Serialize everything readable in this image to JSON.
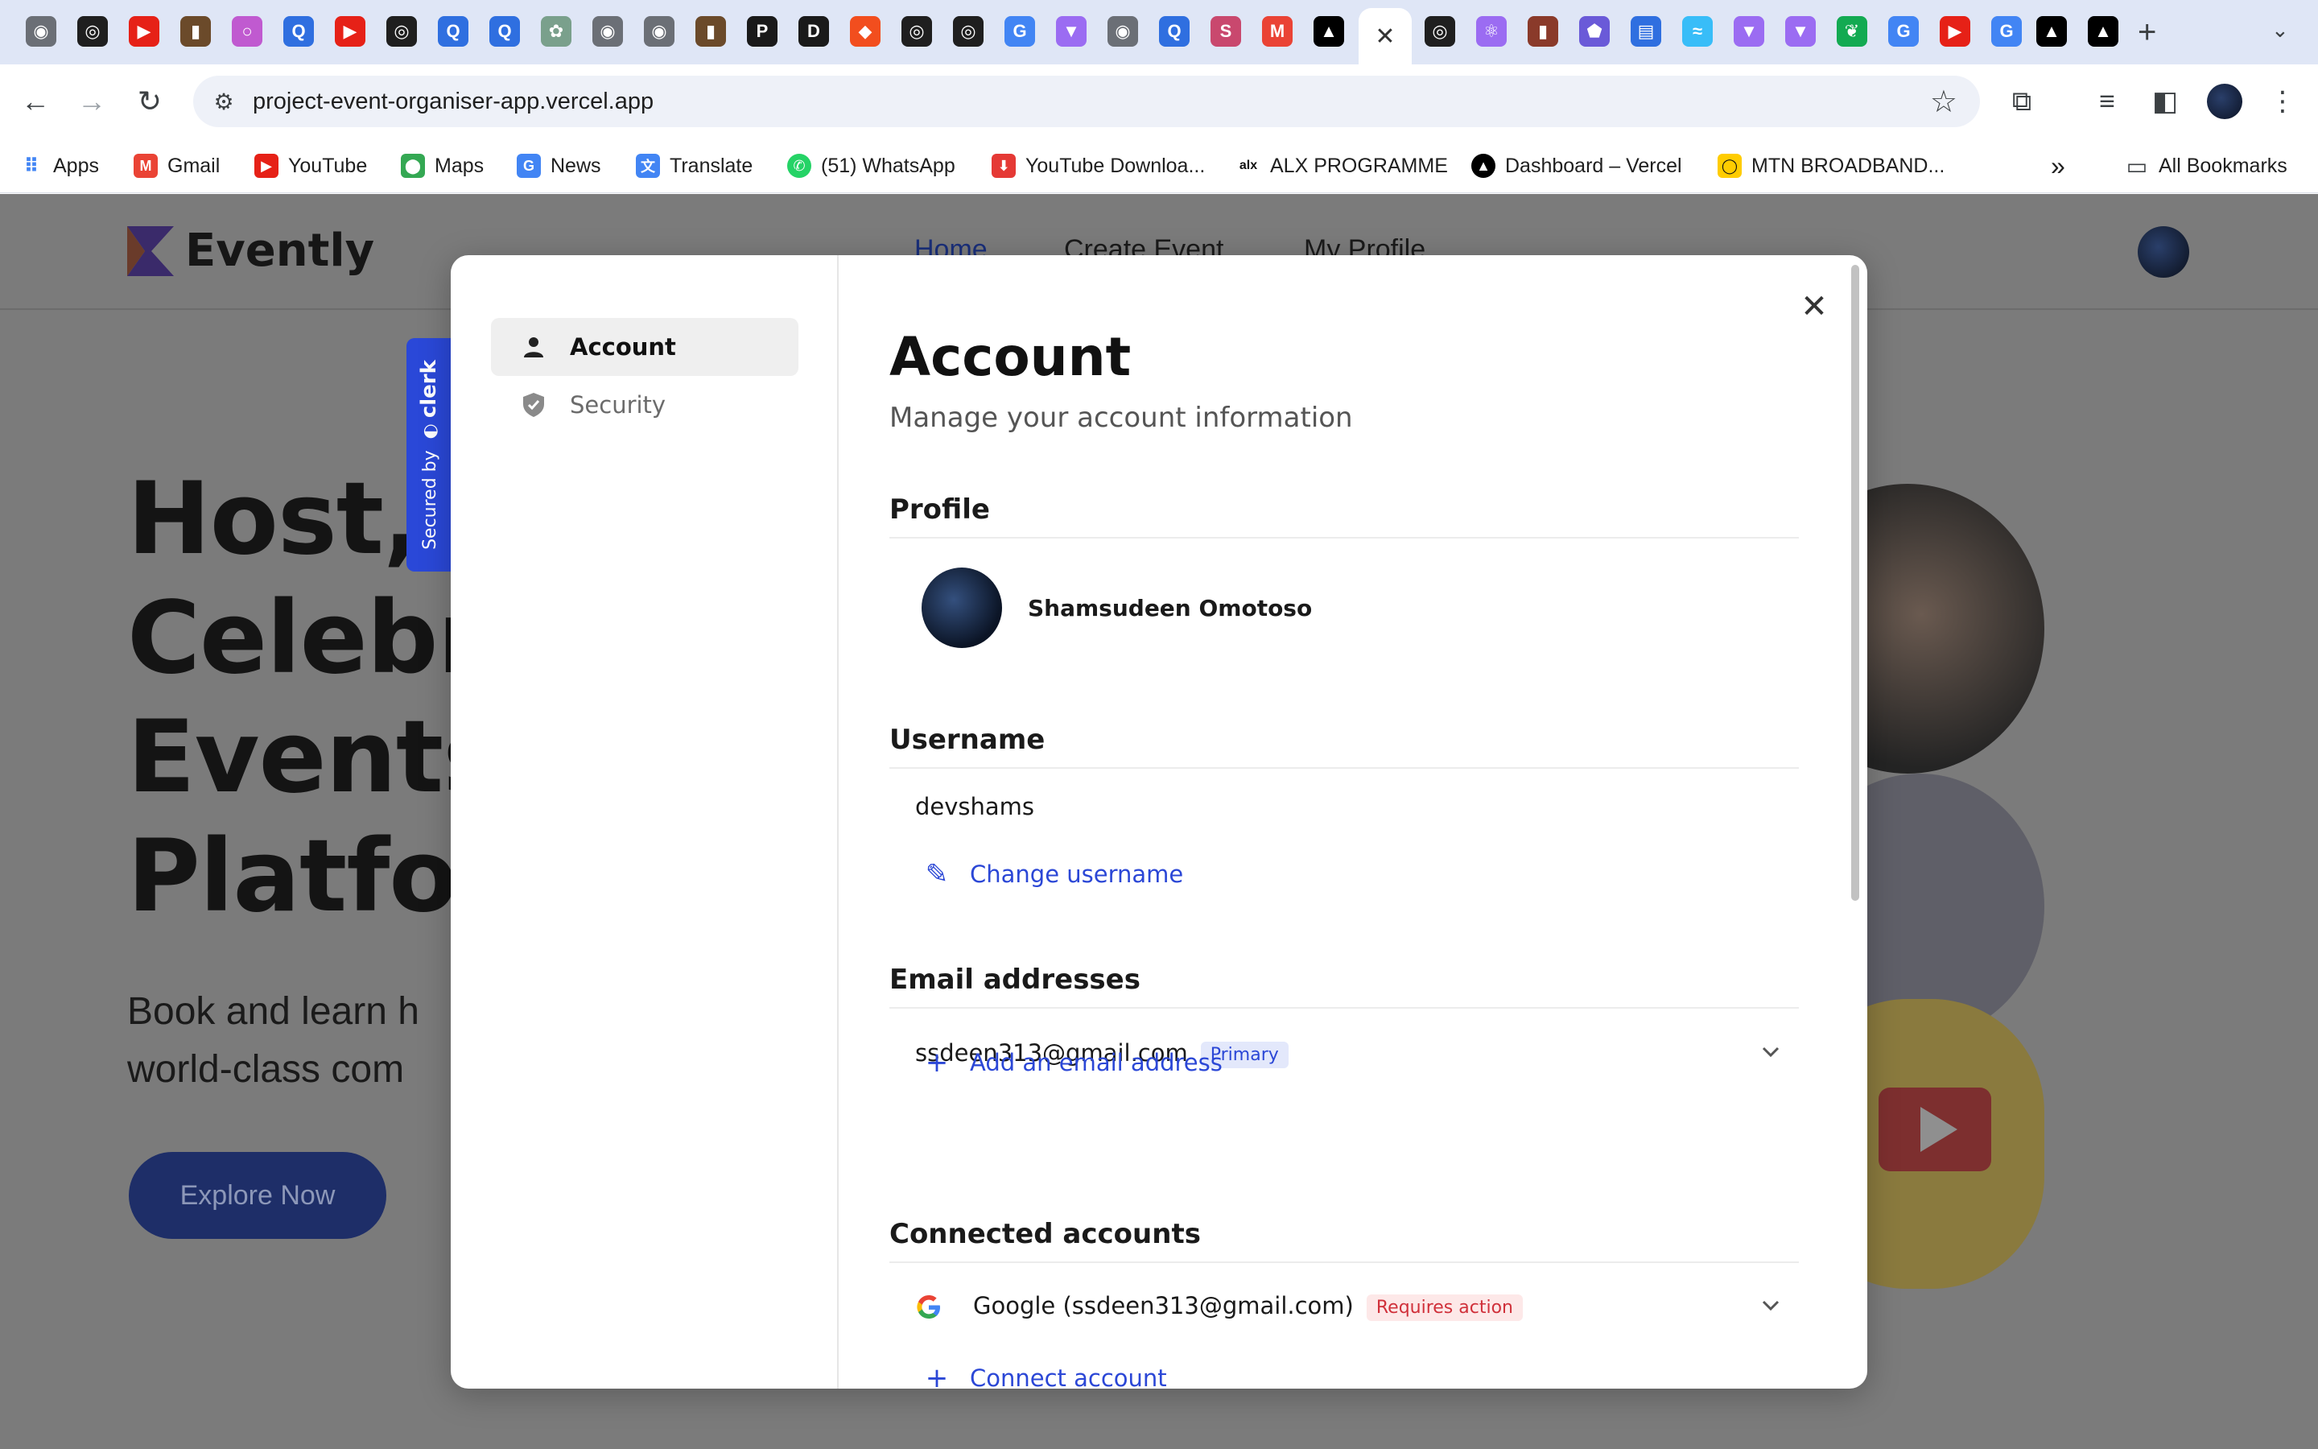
{
  "browser": {
    "url": "project-event-organiser-app.vercel.app",
    "bookmarks": [
      {
        "label": "Apps"
      },
      {
        "label": "Gmail"
      },
      {
        "label": "YouTube"
      },
      {
        "label": "Maps"
      },
      {
        "label": "News"
      },
      {
        "label": "Translate"
      },
      {
        "label": "(51) WhatsApp"
      },
      {
        "label": "YouTube Downloa..."
      },
      {
        "label": "ALX PROGRAMME"
      },
      {
        "label": "Dashboard – Vercel"
      },
      {
        "label": "MTN BROADBAND..."
      }
    ],
    "all_bookmarks": "All Bookmarks",
    "more_bookmarks": "»"
  },
  "page": {
    "logo": "Evently",
    "nav": [
      "Home",
      "Create Event",
      "My Profile"
    ],
    "hero_title": "Host, Connect, Celebrate: Your Events, Our Platform!",
    "hero_title_visible": [
      "Host, C",
      "Celebr",
      "Events",
      "Platfor"
    ],
    "hero_subtitle_visible": [
      "Book and learn h",
      "world-class com"
    ],
    "explore_button": "Explore Now"
  },
  "clerk_badge": {
    "prefix": "Secured by",
    "brand": "clerk"
  },
  "modal": {
    "sidebar": [
      {
        "label": "Account",
        "icon": "user-icon",
        "active": true
      },
      {
        "label": "Security",
        "icon": "shield-icon",
        "active": false
      }
    ],
    "title": "Account",
    "subtitle": "Manage your account information",
    "profile": {
      "section": "Profile",
      "name": "Shamsudeen Omotoso"
    },
    "username": {
      "section": "Username",
      "value": "devshams",
      "action": "Change username"
    },
    "email": {
      "section": "Email addresses",
      "address": "ssdeen313@gmail.com",
      "badge": "Primary",
      "action": "Add an email address"
    },
    "connected": {
      "section": "Connected accounts",
      "provider": "Google (ssdeen313@gmail.com)",
      "badge": "Requires action",
      "action": "Connect account"
    }
  },
  "colors": {
    "accent": "#2b47d6",
    "clerk_blue": "#2a48d8",
    "overlay": "#7b7b7b"
  }
}
